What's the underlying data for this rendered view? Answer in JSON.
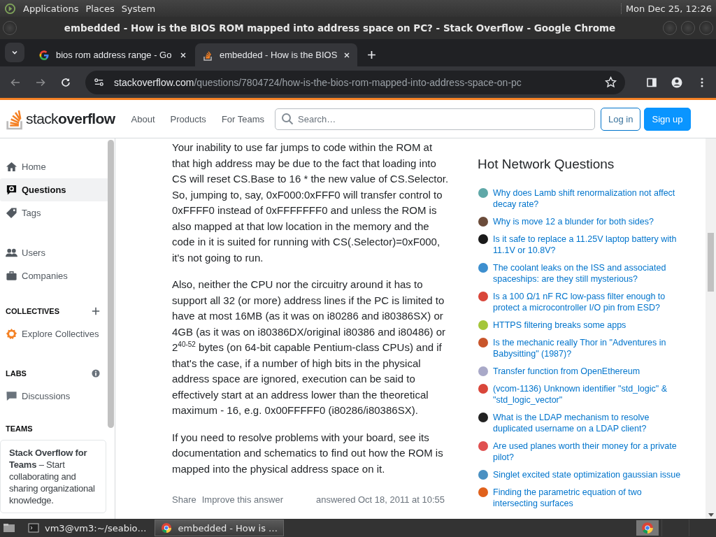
{
  "desktop_panel": {
    "menus": [
      "Applications",
      "Places",
      "System"
    ],
    "clock": "Mon Dec 25, 12:26"
  },
  "window": {
    "title": "embedded - How is the BIOS ROM mapped into address space on PC? - Stack Overflow - Google Chrome"
  },
  "tabs": [
    {
      "label": "bios rom address range - Go",
      "selected": false,
      "kind": "google"
    },
    {
      "label": "embedded - How is the BIOS",
      "selected": true,
      "kind": "stack"
    }
  ],
  "address_bar": {
    "host": "stackoverflow.com",
    "path": "/questions/7804724/how-is-the-bios-rom-mapped-into-address-space-on-pc"
  },
  "site_header": {
    "logo_light": "stack",
    "logo_bold": "overflow",
    "nav": [
      "About",
      "Products",
      "For Teams"
    ],
    "search": {
      "placeholder": "Search…"
    },
    "login": "Log in",
    "signup": "Sign up"
  },
  "sidebar": {
    "groups": [
      {
        "items": [
          {
            "label": "Home",
            "kind": "home",
            "selected": false
          },
          {
            "label": "Questions",
            "kind": "questions",
            "selected": true
          },
          {
            "label": "Tags",
            "kind": "tags",
            "selected": false
          }
        ]
      },
      {
        "items": [
          {
            "label": "Users",
            "kind": "users",
            "selected": false
          },
          {
            "label": "Companies",
            "kind": "companies",
            "selected": false
          }
        ]
      },
      {
        "heading": "COLLECTIVES",
        "add_button": true,
        "items": [
          {
            "label": "Explore Collectives",
            "kind": "collectives",
            "selected": false
          }
        ]
      },
      {
        "heading": "LABS",
        "info_button": true,
        "items": [
          {
            "label": "Discussions",
            "kind": "discussions",
            "selected": false
          }
        ]
      }
    ],
    "teams": {
      "heading": "TEAMS",
      "promo": "**Stack Overflow for Teams** – Start collaborating and sharing organizational knowledge."
    }
  },
  "answer": {
    "paragraphs": [
      "Your inability to use far jumps to code within the ROM at that high address may be due to the fact that loading into CS will reset CS.Base to 16 * the new value of CS.Selector. So, jumping to, say, 0xF000:0xFFF0 will transfer control to 0xFFFF0 instead of 0xFFFFFFF0 and unless the ROM is also mapped at that low location in the memory and the code in it is suited for running with CS(.Selector)=0xF000, it's not going to run.",
      "Also, neither the CPU nor the circuitry around it has to support all 32 (or more) address lines if the PC is limited to have at most 16MB (as it was on i80286 and i80386SX) or 4GB (as it was on i80386DX/original i80386 and i80486) or 2$^{40-52}$ bytes (on 64-bit capable Pentium-class CPUs) and if that's the case, if a number of high bits in the physical address space are ignored, execution can be said to effectively start at an address lower than the theoretical maximum - 16, e.g. 0x00FFFFF0 (i80286/i80386SX).",
      "If you need to resolve problems with your board, see its documentation and schematics to find out how the ROM is mapped into the physical address space on it."
    ],
    "actions": [
      "Share",
      "Improve this answer"
    ],
    "answered": "answered Oct 18, 2011 at 10:55"
  },
  "hot_network": {
    "heading": "Hot Network Questions",
    "items": [
      {
        "title": "Why does Lamb shift renormalization not affect decay rate?",
        "color": "#5fa8a8"
      },
      {
        "title": "Why is move 12 a blunder for both sides?",
        "color": "#6b4c3a"
      },
      {
        "title": "Is it safe to replace a 11.25V laptop battery with 11.1V or 10.8V?",
        "color": "#1a1a1a"
      },
      {
        "title": "The coolant leaks on the ISS and associated spaceships: are they still mysterious?",
        "color": "#3d8fcf"
      },
      {
        "title": "Is a 100 Ω/1 nF RC low-pass filter enough to protect a microcontroller I/O pin from ESD?",
        "color": "#d9463a"
      },
      {
        "title": "HTTPS filtering breaks some apps",
        "color": "#a4c639"
      },
      {
        "title": "Is the mechanic really Thor in \"Adventures in Babysitting\" (1987)?",
        "color": "#c8552b"
      },
      {
        "title": "Transfer function from OpenEthereum",
        "color": "#a9a9c8"
      },
      {
        "title": "(vcom-1136) Unknown identifier \"std_logic\" & \"std_logic_vector\"",
        "color": "#d9463a"
      },
      {
        "title": "What is the LDAP mechanism to resolve duplicated username on a LDAP client?",
        "color": "#222222"
      },
      {
        "title": "Are used planes worth their money for a private pilot?",
        "color": "#e05050"
      },
      {
        "title": "Singlet excited state optimization gaussian issue",
        "color": "#4a90c2"
      },
      {
        "title": "Finding the parametric equation of two intersecting surfaces",
        "color": "#e0611c"
      }
    ]
  },
  "taskbar": {
    "tasks": [
      {
        "label": "vm3@vm3:~/seabio…",
        "kind": "terminal",
        "selected": false
      },
      {
        "label": "embedded - How is …",
        "kind": "browser",
        "selected": true
      }
    ]
  }
}
